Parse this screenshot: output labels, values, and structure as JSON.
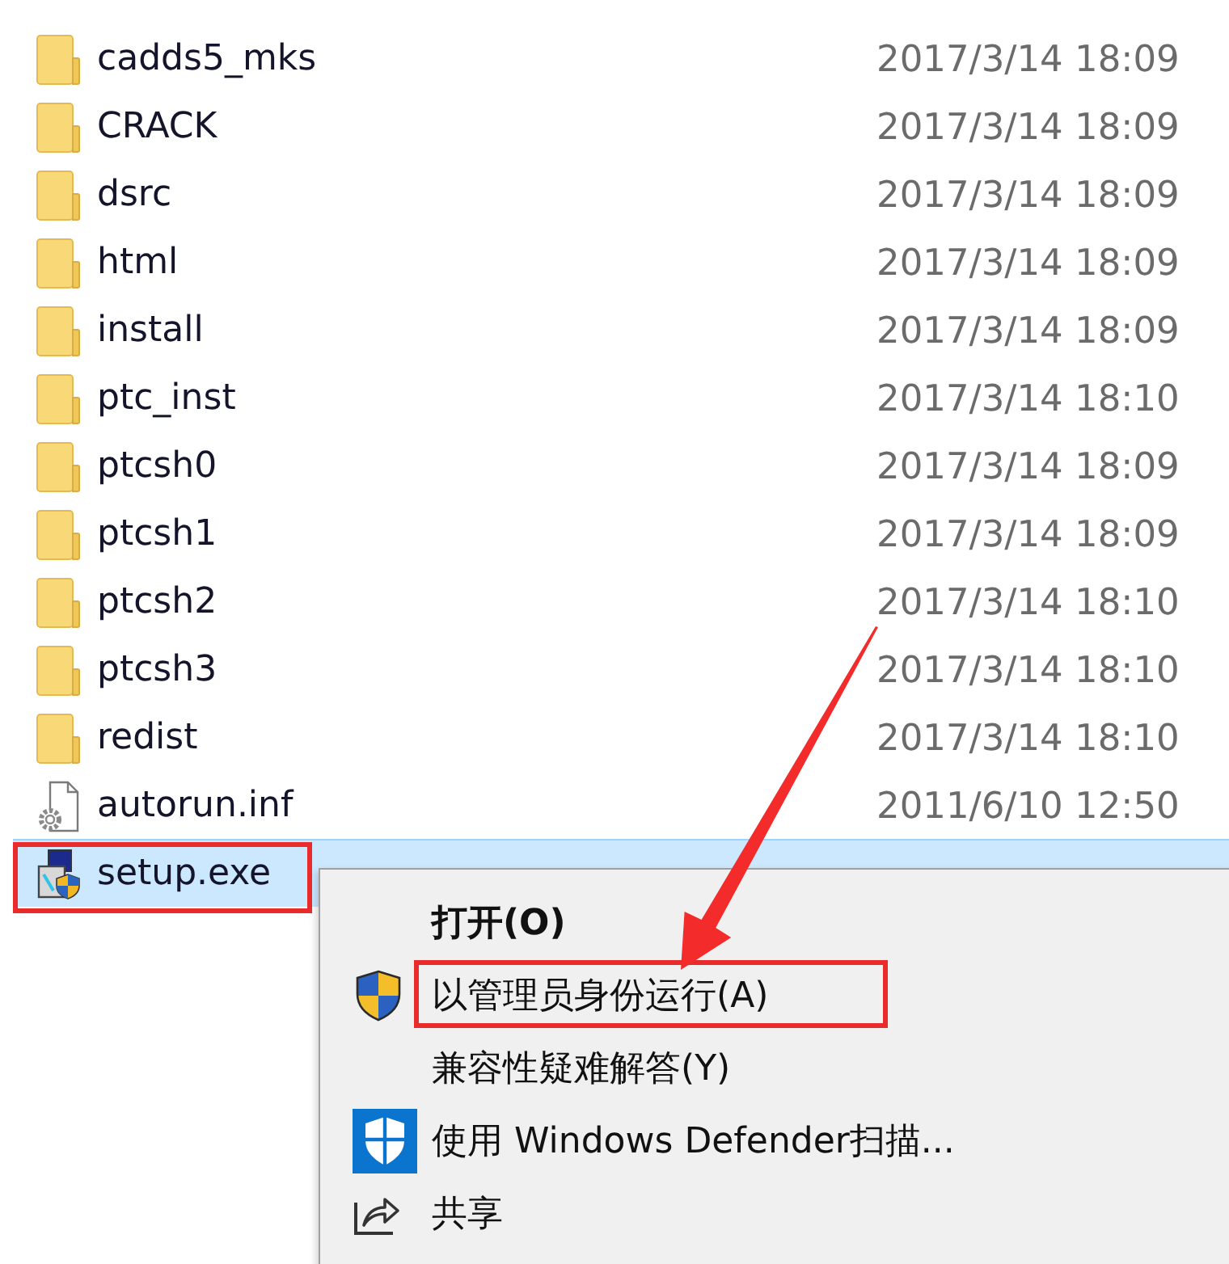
{
  "files": [
    {
      "kind": "folder",
      "name": "cadds5_mks",
      "modified": "2017/3/14 18:09",
      "selected": false,
      "annotated": false
    },
    {
      "kind": "folder",
      "name": "CRACK",
      "modified": "2017/3/14 18:09",
      "selected": false,
      "annotated": false
    },
    {
      "kind": "folder",
      "name": "dsrc",
      "modified": "2017/3/14 18:09",
      "selected": false,
      "annotated": false
    },
    {
      "kind": "folder",
      "name": "html",
      "modified": "2017/3/14 18:09",
      "selected": false,
      "annotated": false
    },
    {
      "kind": "folder",
      "name": "install",
      "modified": "2017/3/14 18:09",
      "selected": false,
      "annotated": false
    },
    {
      "kind": "folder",
      "name": "ptc_inst",
      "modified": "2017/3/14 18:10",
      "selected": false,
      "annotated": false
    },
    {
      "kind": "folder",
      "name": "ptcsh0",
      "modified": "2017/3/14 18:09",
      "selected": false,
      "annotated": false
    },
    {
      "kind": "folder",
      "name": "ptcsh1",
      "modified": "2017/3/14 18:09",
      "selected": false,
      "annotated": false
    },
    {
      "kind": "folder",
      "name": "ptcsh2",
      "modified": "2017/3/14 18:10",
      "selected": false,
      "annotated": false
    },
    {
      "kind": "folder",
      "name": "ptcsh3",
      "modified": "2017/3/14 18:10",
      "selected": false,
      "annotated": false
    },
    {
      "kind": "folder",
      "name": "redist",
      "modified": "2017/3/14 18:10",
      "selected": false,
      "annotated": false
    },
    {
      "kind": "config",
      "name": "autorun.inf",
      "modified": "2011/6/10 12:50",
      "selected": false,
      "annotated": false
    },
    {
      "kind": "program",
      "name": "setup.exe",
      "selected": true,
      "annotated": true
    }
  ],
  "context_menu": {
    "items": [
      {
        "kind": "default",
        "label": "打开(O)",
        "annotated": false
      },
      {
        "kind": "elevated",
        "label": "以管理员身份运行(A)",
        "annotated": true
      },
      {
        "kind": "plain",
        "label": "兼容性疑难解答(Y)",
        "annotated": false
      },
      {
        "kind": "scan",
        "label": "使用 Windows Defender扫描...",
        "annotated": false
      },
      {
        "kind": "share",
        "label": "共享",
        "annotated": false
      }
    ]
  }
}
